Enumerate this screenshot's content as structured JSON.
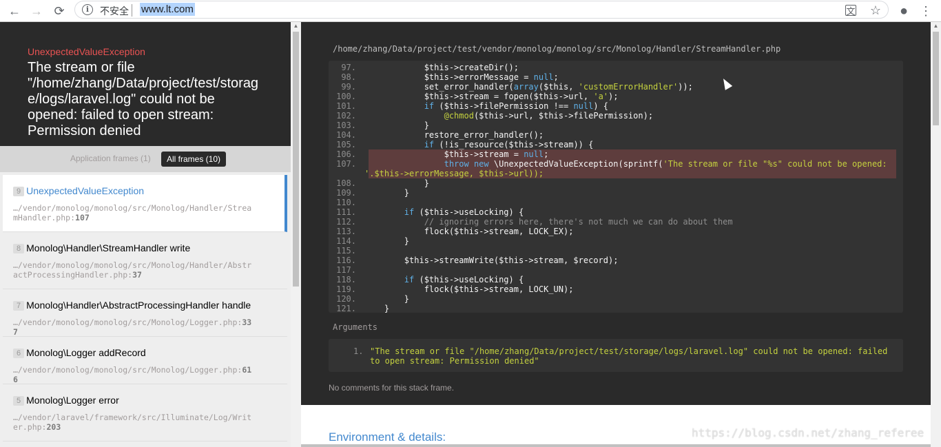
{
  "browser": {
    "insecure_label": "不安全",
    "url": "www.lt.com",
    "back_glyph": "←",
    "forward_glyph": "→",
    "reload_glyph": "⟳",
    "info_glyph": "i",
    "translate_glyph": "文",
    "star_glyph": "☆",
    "account_glyph": "●",
    "menu_glyph": "⋮"
  },
  "exception": {
    "class": "UnexpectedValueException",
    "message": "The stream or file \"/home/zhang/Data/project/test/storage/logs/laravel.log\" could not be opened: failed to open stream: Permission denied"
  },
  "filters": {
    "application": "Application frames (1)",
    "all": "All frames (10)"
  },
  "frames": [
    {
      "num": "9",
      "cls": "UnexpectedValueException",
      "file": "…/vendor/monolog/monolog/src/Monolog/Handler/StreamHandler.php",
      "line": "107"
    },
    {
      "num": "8",
      "cls": "Monolog\\Handler\\StreamHandler write",
      "file": "…/vendor/monolog/monolog/src/Monolog/Handler/AbstractProcessingHandler.php",
      "line": "37"
    },
    {
      "num": "7",
      "cls": "Monolog\\Handler\\AbstractProcessingHandler handle",
      "file": "…/vendor/monolog/monolog/src/Monolog/Logger.php",
      "line": "337"
    },
    {
      "num": "6",
      "cls": "Monolog\\Logger addRecord",
      "file": "…/vendor/monolog/monolog/src/Monolog/Logger.php",
      "line": "616"
    },
    {
      "num": "5",
      "cls": "Monolog\\Logger error",
      "file": "…/vendor/laravel/framework/src/Illuminate/Log/Writer.php",
      "line": "203"
    }
  ],
  "code": {
    "file_path": "/home/zhang/Data/project/test/vendor/monolog/monolog/src/Monolog/Handler/StreamHandler.php",
    "lines": [
      {
        "n": "97.",
        "text": "            $this->createDir();"
      },
      {
        "n": "98.",
        "text": "            $this->errorMessage = null;"
      },
      {
        "n": "99.",
        "text": "            set_error_handler(array($this, 'customErrorHandler'));"
      },
      {
        "n": "100.",
        "text": "            $this->stream = fopen($this->url, 'a');"
      },
      {
        "n": "101.",
        "text": "            if ($this->filePermission !== null) {"
      },
      {
        "n": "102.",
        "text": "                @chmod($this->url, $this->filePermission);"
      },
      {
        "n": "103.",
        "text": "            }"
      },
      {
        "n": "104.",
        "text": "            restore_error_handler();"
      },
      {
        "n": "105.",
        "text": "            if (!is_resource($this->stream)) {"
      },
      {
        "n": "106.",
        "text": "                $this->stream = null;"
      },
      {
        "n": "107.",
        "text": "                throw new \\UnexpectedValueException(sprintf('The stream or file \"%s\" could not be opened: "
      },
      {
        "n": "",
        "text": "'.$this->errorMessage, $this->url));"
      },
      {
        "n": "108.",
        "text": "            }"
      },
      {
        "n": "109.",
        "text": "        }"
      },
      {
        "n": "110.",
        "text": ""
      },
      {
        "n": "111.",
        "text": "        if ($this->useLocking) {"
      },
      {
        "n": "112.",
        "text": "            // ignoring errors here, there's not much we can do about them"
      },
      {
        "n": "113.",
        "text": "            flock($this->stream, LOCK_EX);"
      },
      {
        "n": "114.",
        "text": "        }"
      },
      {
        "n": "115.",
        "text": ""
      },
      {
        "n": "116.",
        "text": "        $this->streamWrite($this->stream, $record);"
      },
      {
        "n": "117.",
        "text": ""
      },
      {
        "n": "118.",
        "text": "        if ($this->useLocking) {"
      },
      {
        "n": "119.",
        "text": "            flock($this->stream, LOCK_UN);"
      },
      {
        "n": "120.",
        "text": "        }"
      },
      {
        "n": "121.",
        "text": "    }"
      }
    ]
  },
  "arguments": {
    "title": "Arguments",
    "items": [
      {
        "num": "1.",
        "value": "\"The stream or file \"/home/zhang/Data/project/test/storage/logs/laravel.log\" could not be opened: failed to open stream: Permission denied\""
      }
    ]
  },
  "comments": "No comments for this stack frame.",
  "env_title": "Environment & details:",
  "watermark": "https://blog.csdn.net/zhang_referee",
  "colors": {
    "accent": "#4288ce",
    "exception_red": "#e95353",
    "dark_bg": "#2a2a2a",
    "string_green": "#c4d13f",
    "keyword_blue": "#5fb0e6",
    "highlight": "#e05b5b"
  }
}
